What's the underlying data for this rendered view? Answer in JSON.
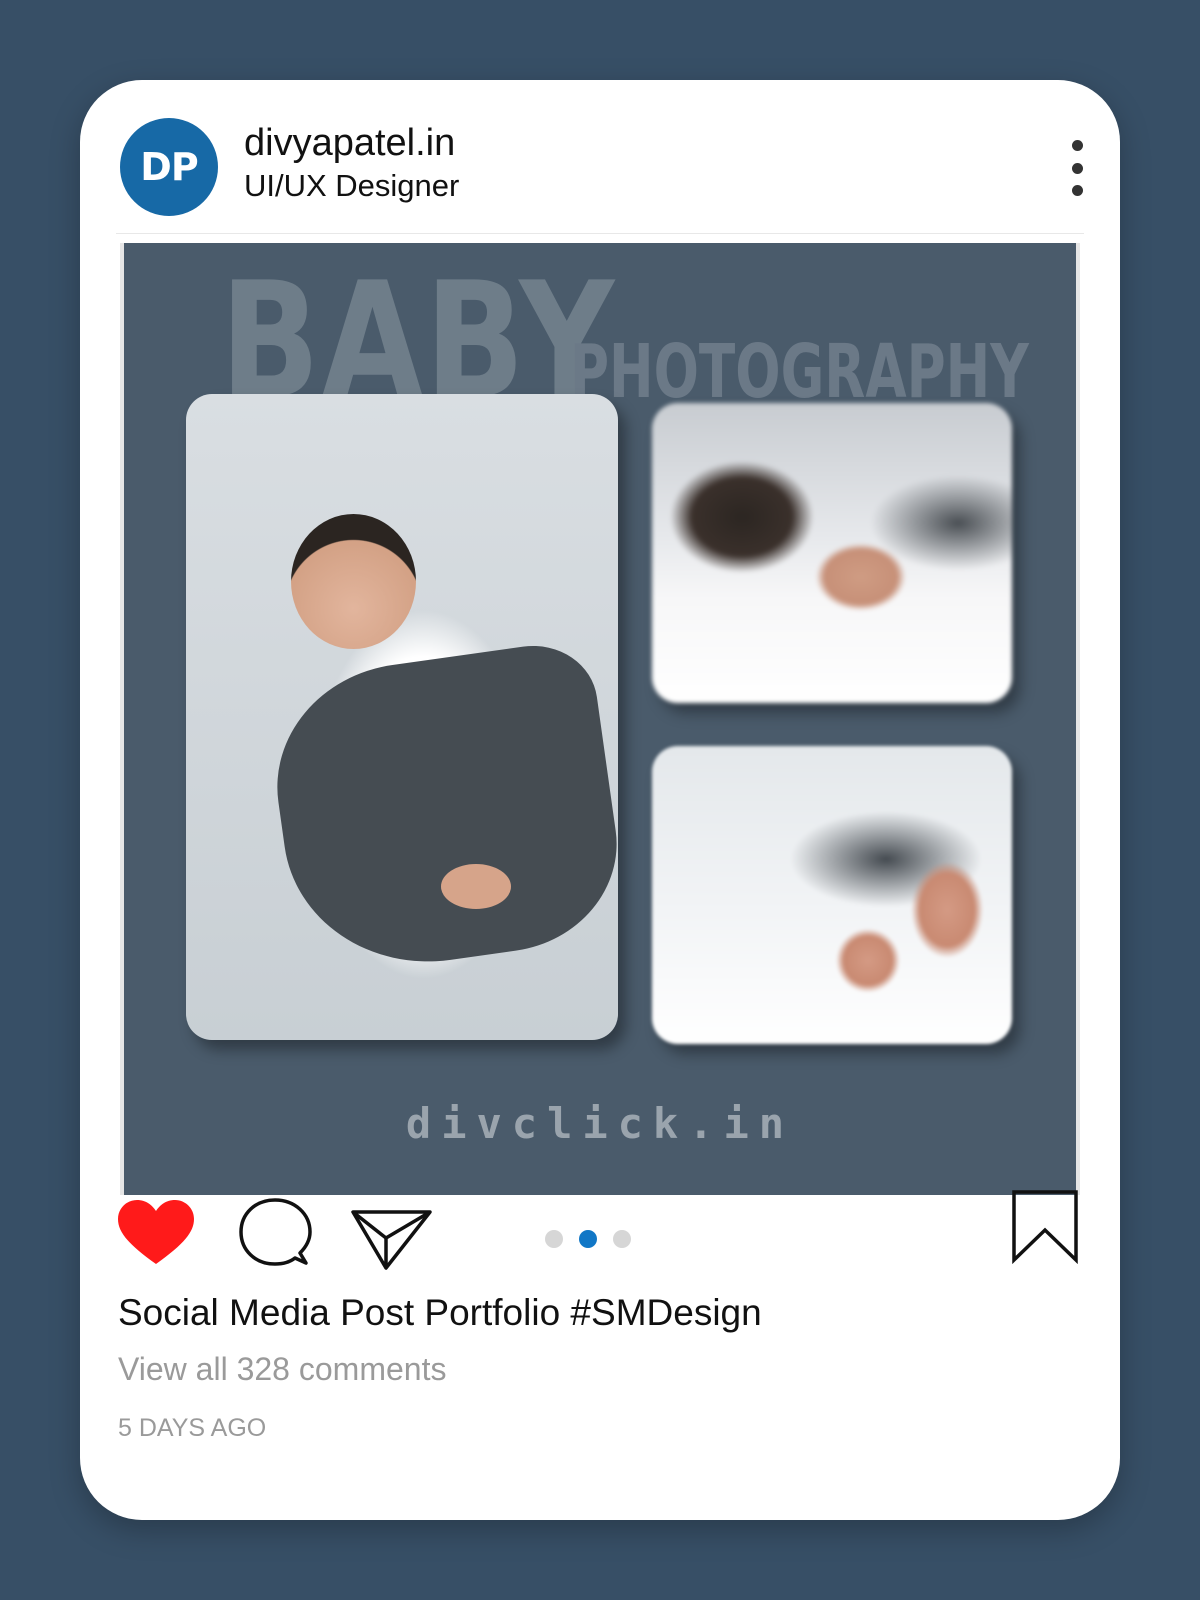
{
  "post": {
    "avatar_initials": "DP",
    "username": "divyapatel.in",
    "subtitle": "UI/UX Designer",
    "media": {
      "title_large": "BABY",
      "title_small": "PHOTOGRAPHY",
      "watermark": "divclick.in"
    },
    "carousel": {
      "total": 3,
      "active_index": 1
    },
    "caption": "Social Media Post Portfolio #SMDesign",
    "comments_link": "View all 328 comments",
    "timestamp": "5 DAYS AGO"
  },
  "icons": {
    "more": "more-vertical-icon",
    "like": "heart-icon",
    "comment": "comment-icon",
    "share": "send-icon",
    "save": "bookmark-icon"
  },
  "colors": {
    "background": "#374f66",
    "card": "#ffffff",
    "avatar": "#1769a6",
    "media_background": "#4a5b6b",
    "like": "#ff1a1a",
    "active_dot": "#1177c6"
  }
}
